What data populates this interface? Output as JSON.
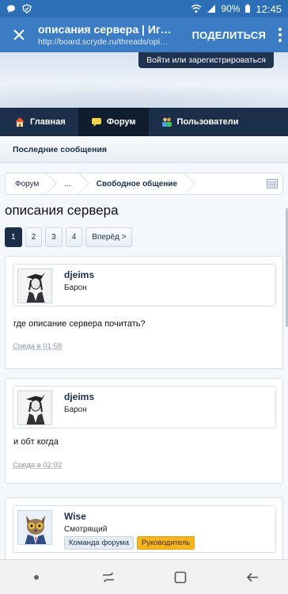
{
  "status": {
    "battery": "90%",
    "time": "12:45"
  },
  "browser": {
    "title": "описания сервера | Игро…",
    "url": "http://board.scryde.ru/threads/opi…",
    "share_label": "ПОДЕЛИТЬСЯ"
  },
  "site": {
    "login_label": "Войти или зарегистрироваться",
    "nav": [
      {
        "label": "Главная",
        "icon": "home-icon"
      },
      {
        "label": "Форум",
        "icon": "forum-icon"
      },
      {
        "label": "Пользователи",
        "icon": "users-icon"
      }
    ],
    "subnav_label": "Последние сообщения"
  },
  "breadcrumbs": [
    "Форум",
    "...",
    "Свободное общение"
  ],
  "page_title": "описания сервера",
  "pagination": {
    "pages": [
      "1",
      "2",
      "3",
      "4"
    ],
    "next_label": "Вперёд >",
    "current": "1"
  },
  "posts": [
    {
      "username": "djeims",
      "user_title": "Барон",
      "text": "где описание сервера почитать?",
      "date": "Среда в 01:58",
      "avatar": "witch-avatar-icon"
    },
    {
      "username": "djeims",
      "user_title": "Барон",
      "text": "и обт когда",
      "date": "Среда в 02:02",
      "avatar": "witch-avatar-icon"
    },
    {
      "username": "Wise",
      "user_title": "Смотрящий",
      "badges": [
        "Команда форума",
        "Руководитель"
      ],
      "avatar": "owl-avatar-icon"
    }
  ],
  "colors": {
    "header": "#3b7cc4",
    "nav": "#1b2f4a",
    "badge_lead": "#f5b51f"
  }
}
